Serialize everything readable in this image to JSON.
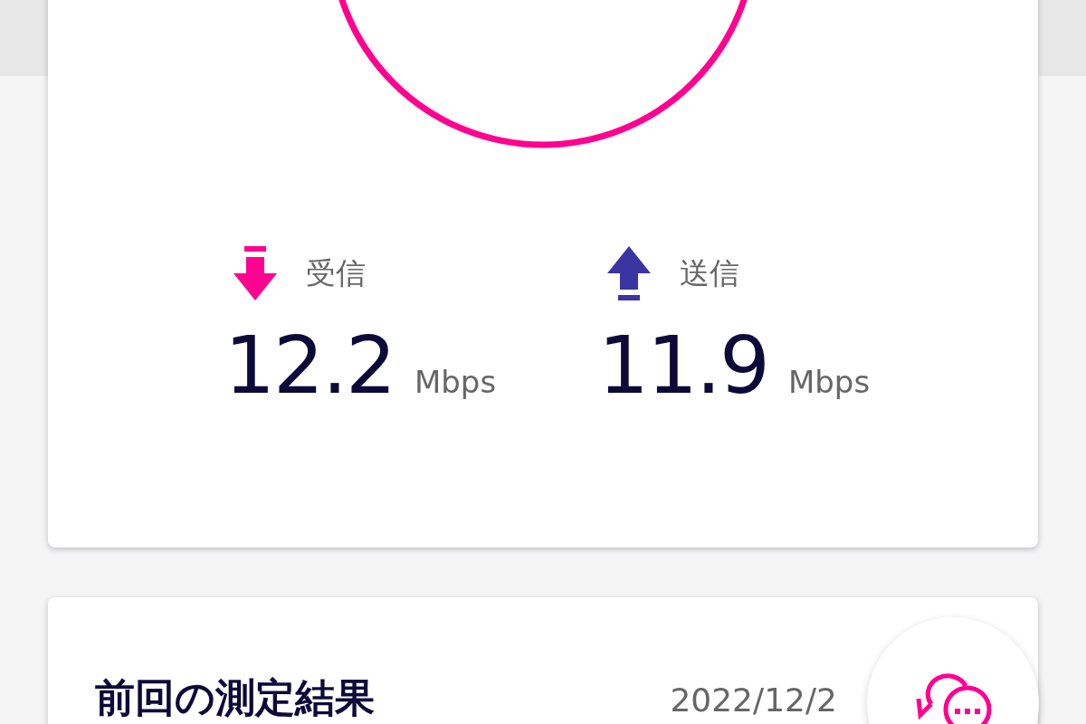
{
  "speeds": [
    {
      "kind": "download",
      "label": "受信",
      "value": "12.2",
      "unit": "Mbps"
    },
    {
      "kind": "upload",
      "label": "送信",
      "value": "11.9",
      "unit": "Mbps"
    }
  ],
  "previous": {
    "title": "前回の測定結果",
    "date": "2022/12/2"
  }
}
